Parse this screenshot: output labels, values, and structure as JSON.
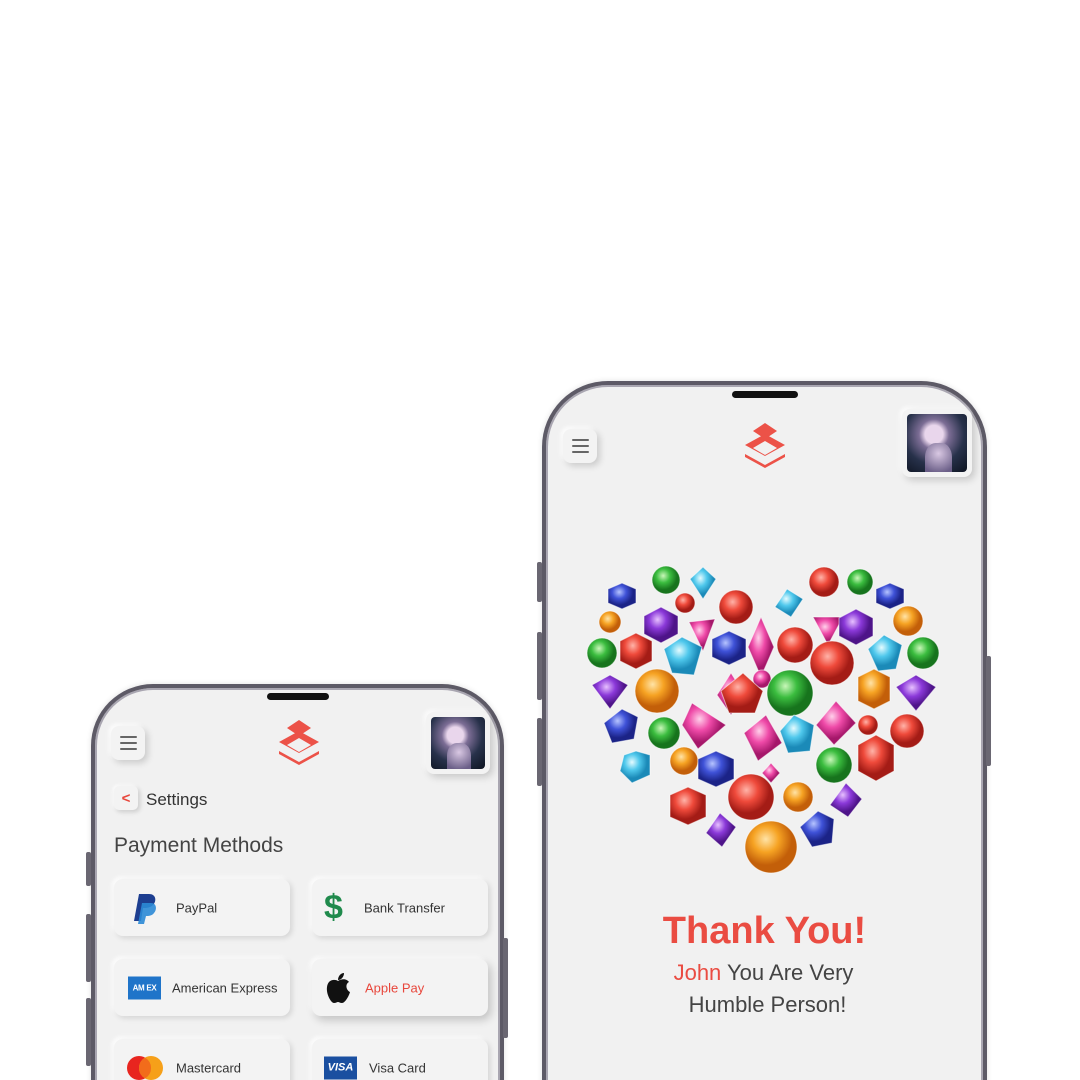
{
  "colors": {
    "accent": "#ea4c42",
    "text": "#444444",
    "background": "#f1f1f1"
  },
  "left_screen": {
    "header": {
      "menu_icon": "hamburger-icon",
      "logo": "layers-logo",
      "avatar": "user-avatar"
    },
    "back_icon": "chevron-left-icon",
    "back_glyph": "<",
    "settings_label": "Settings",
    "section_title": "Payment Methods",
    "payment_methods": [
      {
        "label": "PayPal",
        "icon": "paypal-icon"
      },
      {
        "label": "Bank Transfer",
        "icon": "dollar-icon",
        "glyph": "$"
      },
      {
        "label": "American Express",
        "icon": "amex-icon",
        "glyph": "AM EX"
      },
      {
        "label": "Apple Pay",
        "icon": "apple-icon",
        "selected": true
      },
      {
        "label": "Mastercard",
        "icon": "mastercard-icon"
      },
      {
        "label": "Visa Card",
        "icon": "visa-icon",
        "glyph": "VISA"
      }
    ]
  },
  "right_screen": {
    "header": {
      "menu_icon": "hamburger-icon",
      "logo": "layers-logo",
      "avatar": "user-avatar"
    },
    "illustration": "gem-heart-illustration",
    "title": "Thank You!",
    "name": "John",
    "message_rest": " You Are Very",
    "message_line2": "Humble Person!"
  }
}
